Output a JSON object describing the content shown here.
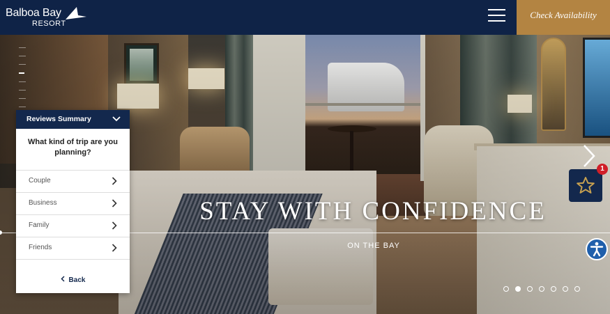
{
  "header": {
    "logo_line1": "Balboa Bay",
    "logo_line2": "RESORT",
    "check_availability": "Check Availability"
  },
  "hero": {
    "title": "STAY WITH CONFIDENCE",
    "subtitle": "ON THE BAY",
    "slide_count": 7,
    "active_slide": 2
  },
  "reviews_panel": {
    "title": "Reviews Summary",
    "question": "What kind of trip are you planning?",
    "options": [
      "Couple",
      "Business",
      "Family",
      "Friends"
    ],
    "back_label": "Back"
  },
  "review_badge": {
    "count": "1"
  },
  "colors": {
    "navy": "#0f2347",
    "gold": "#b38442",
    "badge_red": "#d01f28",
    "accessibility_blue": "#1f5fab"
  }
}
